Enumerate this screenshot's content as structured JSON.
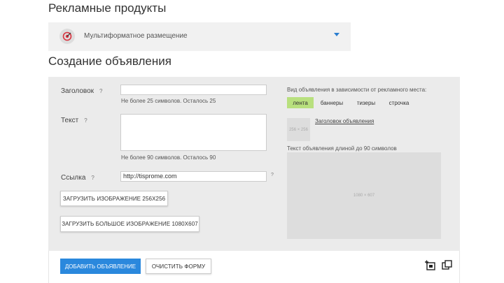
{
  "page": {
    "section_products_title": "Рекламные продукты",
    "section_create_title": "Создание объявления"
  },
  "product_select": {
    "value": "Мультиформатное размещение",
    "accent_color": "#d9333f",
    "icon": "target-icon"
  },
  "form": {
    "title_label": "Заголовок",
    "title_help": "?",
    "title_value": "",
    "title_hint": "Не более 25 символов. Осталось 25",
    "text_label": "Текст",
    "text_help": "?",
    "text_value": "",
    "text_hint": "Не более 90 символов. Осталось 90",
    "link_label": "Ссылка",
    "link_help": "?",
    "link_value": "http://tisprome.com",
    "link_extra": "?",
    "upload_image_button": "ЗАГРУЗИТЬ ИЗОБРАЖЕНИЕ 256X256",
    "upload_big_image_button": "ЗАГРУЗИТЬ БОЛЬШОЕ ИЗОБРАЖЕНИЕ 1080X607"
  },
  "preview": {
    "title": "Вид объявления в зависимости от рекламного места:",
    "tabs": [
      "лента",
      "баннеры",
      "тизеры",
      "строчка"
    ],
    "active_tab": "лента",
    "active_color": "#b8e07e",
    "thumb_label": "256 × 256",
    "headline": "Заголовок объявления",
    "text": "Текст объявления длиной до 90 символов",
    "big_image_label": "1080 × 607"
  },
  "actions": {
    "add_button": "ДОБАВИТЬ ОБЪЯВЛЕНИЕ",
    "add_color": "#2a88dd",
    "clear_button": "ОЧИСТИТЬ ФОРМУ",
    "icons": [
      "add-image-icon",
      "copy-icon"
    ]
  }
}
